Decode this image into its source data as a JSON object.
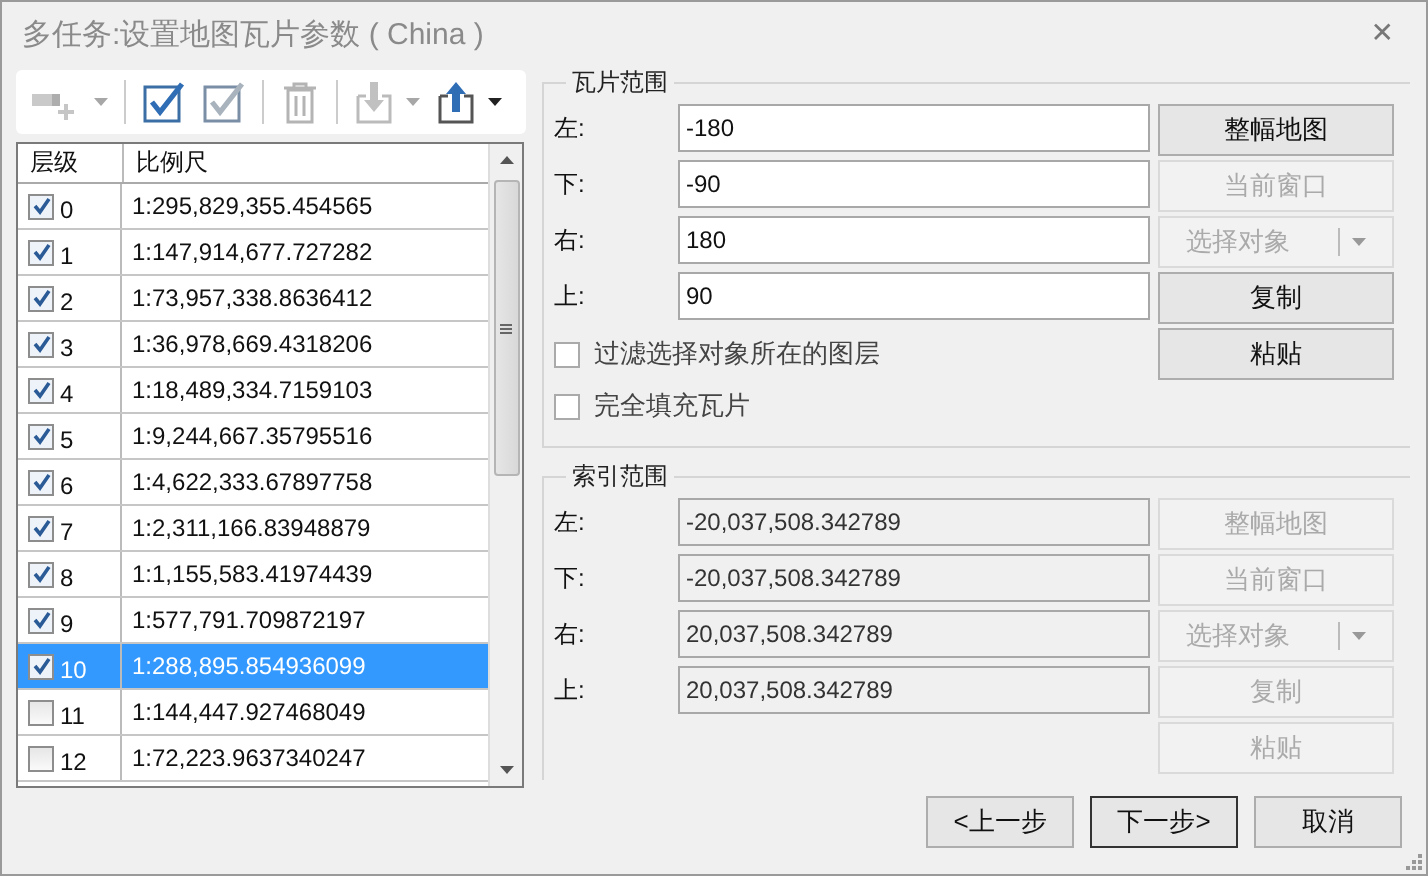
{
  "window": {
    "title": "多任务:设置地图瓦片参数 ( China )",
    "close": "✕"
  },
  "toolbar": [
    {
      "kind": "add-layer",
      "disabled": true,
      "dropdown": true
    },
    {
      "kind": "check-all",
      "disabled": false,
      "dropdown": false
    },
    {
      "kind": "uncheck-all",
      "disabled": false,
      "dropdown": false
    },
    {
      "kind": "delete",
      "disabled": true,
      "dropdown": false
    },
    {
      "kind": "import",
      "disabled": true,
      "dropdown": true
    },
    {
      "kind": "export",
      "disabled": false,
      "dropdown": true
    }
  ],
  "table": {
    "columns": [
      "层级",
      "比例尺"
    ],
    "rows": [
      {
        "level": "0",
        "scale": "1:295,829,355.454565",
        "checked": true,
        "selected": false
      },
      {
        "level": "1",
        "scale": "1:147,914,677.727282",
        "checked": true,
        "selected": false
      },
      {
        "level": "2",
        "scale": "1:73,957,338.8636412",
        "checked": true,
        "selected": false
      },
      {
        "level": "3",
        "scale": "1:36,978,669.4318206",
        "checked": true,
        "selected": false
      },
      {
        "level": "4",
        "scale": "1:18,489,334.7159103",
        "checked": true,
        "selected": false
      },
      {
        "level": "5",
        "scale": "1:9,244,667.35795516",
        "checked": true,
        "selected": false
      },
      {
        "level": "6",
        "scale": "1:4,622,333.67897758",
        "checked": true,
        "selected": false
      },
      {
        "level": "7",
        "scale": "1:2,311,166.83948879",
        "checked": true,
        "selected": false
      },
      {
        "level": "8",
        "scale": "1:1,155,583.41974439",
        "checked": true,
        "selected": false
      },
      {
        "level": "9",
        "scale": "1:577,791.709872197",
        "checked": true,
        "selected": false
      },
      {
        "level": "10",
        "scale": "1:288,895.854936099",
        "checked": true,
        "selected": true
      },
      {
        "level": "11",
        "scale": "1:144,447.927468049",
        "checked": false,
        "selected": false
      },
      {
        "level": "12",
        "scale": "1:72,223.9637340247",
        "checked": false,
        "selected": false
      }
    ]
  },
  "groups": [
    {
      "title": "瓦片范围",
      "fields": [
        {
          "label": "左:",
          "value": "-180",
          "disabled": false
        },
        {
          "label": "下:",
          "value": "-90",
          "disabled": false
        },
        {
          "label": "右:",
          "value": "180",
          "disabled": false
        },
        {
          "label": "上:",
          "value": "90",
          "disabled": false
        }
      ],
      "buttons": [
        {
          "label": "整幅地图",
          "kind": "plain",
          "disabled": false
        },
        {
          "label": "当前窗口",
          "kind": "plain",
          "disabled": true
        },
        {
          "label": "选择对象",
          "kind": "split",
          "disabled": true
        },
        {
          "label": "复制",
          "kind": "plain",
          "disabled": false
        },
        {
          "label": "粘贴",
          "kind": "plain",
          "disabled": false
        }
      ],
      "options": [
        {
          "label": "过滤选择对象所在的图层",
          "checked": false
        },
        {
          "label": "完全填充瓦片",
          "checked": false
        }
      ]
    },
    {
      "title": "索引范围",
      "fields": [
        {
          "label": "左:",
          "value": "-20,037,508.342789",
          "disabled": true
        },
        {
          "label": "下:",
          "value": "-20,037,508.342789",
          "disabled": true
        },
        {
          "label": "右:",
          "value": "20,037,508.342789",
          "disabled": true
        },
        {
          "label": "上:",
          "value": "20,037,508.342789",
          "disabled": true
        }
      ],
      "buttons": [
        {
          "label": "整幅地图",
          "kind": "plain",
          "disabled": true
        },
        {
          "label": "当前窗口",
          "kind": "plain",
          "disabled": true
        },
        {
          "label": "选择对象",
          "kind": "split",
          "disabled": true
        },
        {
          "label": "复制",
          "kind": "plain",
          "disabled": true
        },
        {
          "label": "粘贴",
          "kind": "plain",
          "disabled": true
        }
      ]
    }
  ],
  "footer": [
    {
      "label": "<上一步",
      "default": false
    },
    {
      "label": "下一步>",
      "default": true
    },
    {
      "label": "取消",
      "default": false
    }
  ]
}
